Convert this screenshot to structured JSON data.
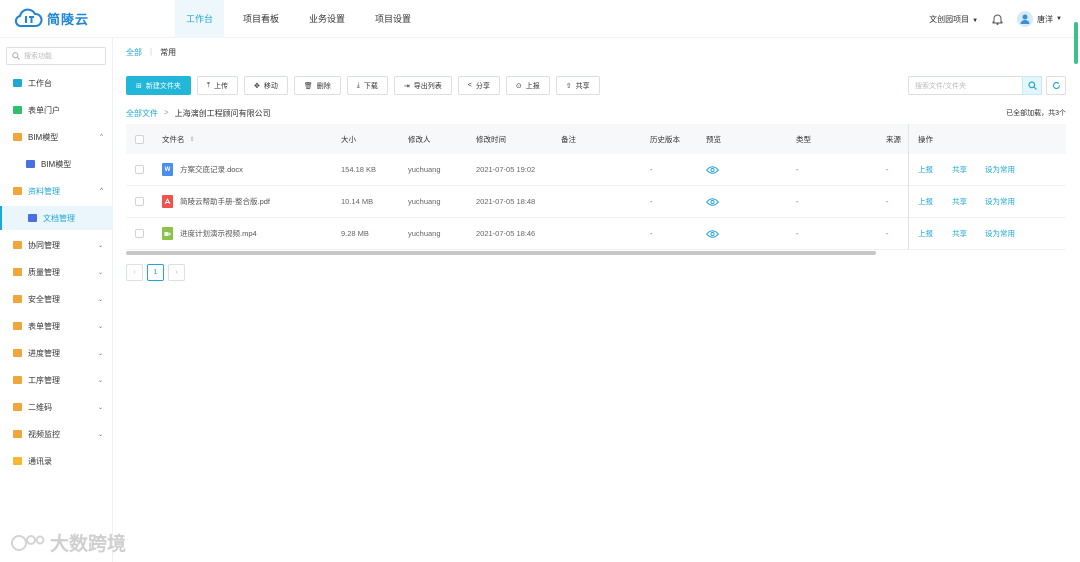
{
  "brand": {
    "name": "简陵云"
  },
  "nav": {
    "items": [
      "工作台",
      "项目看板",
      "业务设置",
      "项目设置"
    ],
    "active": 0
  },
  "header_right": {
    "project": "文创园项目",
    "user": "唐洋"
  },
  "sidebar": {
    "search_placeholder": "搜索功能",
    "items": [
      {
        "label": "工作台",
        "icon": "workbench-icon"
      },
      {
        "label": "表单门户",
        "icon": "form-portal-icon"
      },
      {
        "label": "BIM模型",
        "icon": "folder-icon",
        "expanded": true
      },
      {
        "label": "BIM模型",
        "icon": "bim-model-icon"
      },
      {
        "label": "资料管理",
        "icon": "folder-icon",
        "expanded": true
      },
      {
        "label": "文档管理",
        "icon": "document-manage-icon"
      },
      {
        "label": "协同管理",
        "icon": "folder-icon"
      },
      {
        "label": "质量管理",
        "icon": "folder-icon"
      },
      {
        "label": "安全管理",
        "icon": "folder-icon"
      },
      {
        "label": "表单管理",
        "icon": "folder-icon"
      },
      {
        "label": "进度管理",
        "icon": "folder-icon"
      },
      {
        "label": "工序管理",
        "icon": "folder-icon"
      },
      {
        "label": "二维码",
        "icon": "folder-icon"
      },
      {
        "label": "视频监控",
        "icon": "folder-icon"
      },
      {
        "label": "通讯录",
        "icon": "contacts-icon"
      }
    ]
  },
  "breadcrumb_top": {
    "all": "全部",
    "current": "常用"
  },
  "toolbar": {
    "new_folder": "新建文件夹",
    "upload": "上传",
    "move": "移动",
    "delete": "删除",
    "download": "下载",
    "export": "导出列表",
    "share": "分享",
    "report": "上报",
    "share2": "共享"
  },
  "search": {
    "placeholder": "搜索文件/文件夹"
  },
  "path": {
    "root": "全部文件",
    "folder": "上海漓创工程顾问有限公司"
  },
  "loaded_text": "已全部加载，共3个",
  "table": {
    "headers": {
      "name": "文件名",
      "size": "大小",
      "modifier": "修改人",
      "time": "修改时间",
      "note": "备注",
      "history": "历史版本",
      "preview": "预览",
      "type": "类型",
      "source": "来源",
      "ops": "操作"
    },
    "rows": [
      {
        "name": "方案交底记录.docx",
        "size": "154.18 KB",
        "modifier": "yuchuang",
        "time": "2021-07-05 19:02",
        "history": "-",
        "type": "-",
        "source": "-",
        "icon": "word-file-icon",
        "icon_color": "#4a8ef0",
        "icon_char": "W"
      },
      {
        "name": "简陵云帮助手册-整合版.pdf",
        "size": "10.14 MB",
        "modifier": "yuchuang",
        "time": "2021-07-05 18:48",
        "history": "-",
        "type": "-",
        "source": "-",
        "icon": "pdf-file-icon",
        "icon_color": "#ef5350",
        "icon_char": ""
      },
      {
        "name": "进度计划演示视频.mp4",
        "size": "9.28 MB",
        "modifier": "yuchuang",
        "time": "2021-07-05 18:46",
        "history": "-",
        "type": "-",
        "source": "-",
        "icon": "video-file-icon",
        "icon_color": "#8bc34a",
        "icon_char": ""
      }
    ],
    "ops": {
      "report": "上报",
      "share": "共享",
      "set_common": "设为常用"
    }
  },
  "pager": {
    "page": "1"
  },
  "watermark": "大数跨境",
  "colors": {
    "accent": "#1fa8d6",
    "primary_button": "#22b6d8",
    "folder": "#f0a63a"
  }
}
